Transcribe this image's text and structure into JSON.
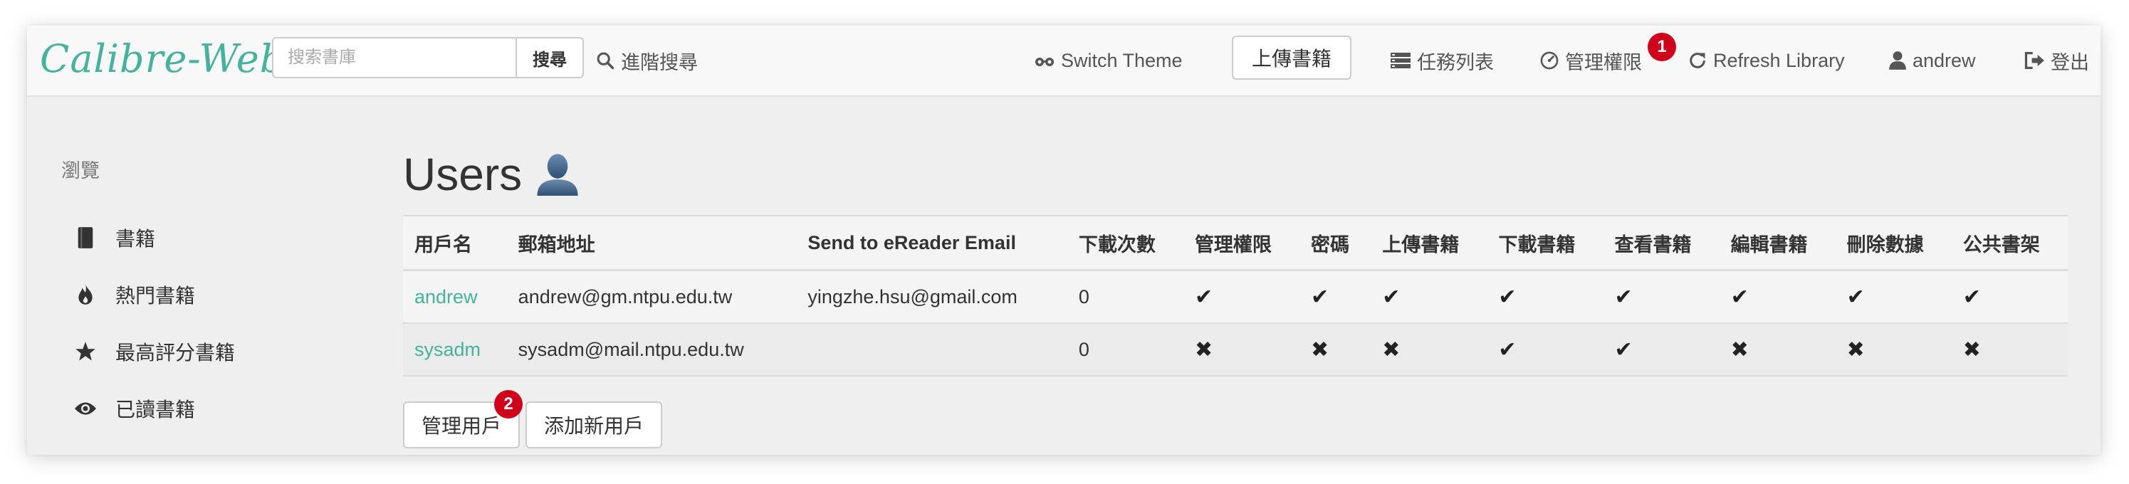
{
  "app": {
    "brand": "Calibre-Web"
  },
  "search": {
    "placeholder": "搜索書庫",
    "button_label": "搜尋"
  },
  "nav": {
    "advanced_search": "進階搜尋",
    "switch_theme": "Switch Theme",
    "upload": "上傳書籍",
    "tasks": "任務列表",
    "admin": "管理權限",
    "admin_badge": "1",
    "refresh": "Refresh Library",
    "user": "andrew",
    "logout": "登出"
  },
  "sidebar": {
    "header": "瀏覽",
    "items": [
      {
        "label": "書籍",
        "icon": "book-icon"
      },
      {
        "label": "熱門書籍",
        "icon": "fire-icon"
      },
      {
        "label": "最高評分書籍",
        "icon": "star-icon"
      },
      {
        "label": "已讀書籍",
        "icon": "eye-icon"
      }
    ]
  },
  "main": {
    "title": "Users",
    "table": {
      "columns": [
        "用戶名",
        "郵箱地址",
        "Send to eReader Email",
        "下載次數",
        "管理權限",
        "密碼",
        "上傳書籍",
        "下載書籍",
        "查看書籍",
        "編輯書籍",
        "刪除數據",
        "公共書架"
      ],
      "rows": [
        {
          "username": "andrew",
          "email": "andrew@gm.ntpu.edu.tw",
          "ereader": "yingzhe.hsu@gmail.com",
          "downloads": "0",
          "perms": [
            "✔",
            "✔",
            "✔",
            "✔",
            "✔",
            "✔",
            "✔",
            "✔"
          ]
        },
        {
          "username": "sysadm",
          "email": "sysadm@mail.ntpu.edu.tw",
          "ereader": "",
          "downloads": "0",
          "perms": [
            "✖",
            "✖",
            "✖",
            "✔",
            "✔",
            "✖",
            "✖",
            "✖"
          ]
        }
      ]
    },
    "manage_users_button": "管理用戶",
    "manage_users_badge": "2",
    "add_user_button": "添加新用戶"
  },
  "colors": {
    "accent": "#45b29d",
    "badge": "#d0021b"
  }
}
